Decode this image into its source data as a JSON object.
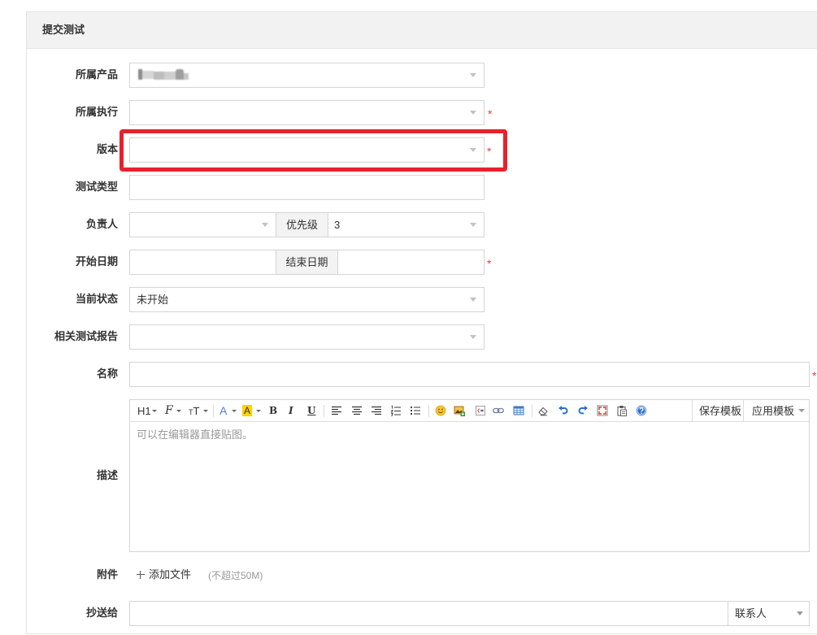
{
  "panel": {
    "title": "提交测试"
  },
  "required_mark": "*",
  "form": {
    "product": {
      "label": "所属产品"
    },
    "execution": {
      "label": "所属执行"
    },
    "build": {
      "label": "版本"
    },
    "type": {
      "label": "测试类型"
    },
    "owner": {
      "label": "负责人"
    },
    "priority": {
      "label": "优先级",
      "value": "3"
    },
    "begin": {
      "label": "开始日期"
    },
    "end": {
      "label": "结束日期"
    },
    "status": {
      "label": "当前状态",
      "value": "未开始"
    },
    "report": {
      "label": "相关测试报告"
    },
    "name": {
      "label": "名称"
    },
    "desc": {
      "label": "描述",
      "placeholder": "可以在编辑器直接贴图。"
    },
    "files": {
      "label": "附件",
      "add_label": "添加文件",
      "limit_note": "(不超过50M)"
    },
    "mailto": {
      "label": "抄送给",
      "contacts_label": "联系人"
    }
  },
  "editor": {
    "toolbar": {
      "heading": {
        "label": "H1",
        "icon": "heading-icon"
      },
      "font_family": {
        "label": "F",
        "icon": "font-family-icon"
      },
      "font_size": {
        "label": "T",
        "icon": "font-size-icon"
      },
      "font_color": {
        "label": "A",
        "icon": "font-color-icon",
        "color": "#4f80da"
      },
      "bg_color": {
        "label": "A",
        "icon": "background-color-icon",
        "color": "#ffd200"
      },
      "bold": {
        "label": "B"
      },
      "italic": {
        "label": "I"
      },
      "underline": {
        "label": "U"
      },
      "icons": [
        "align-left-icon",
        "align-center-icon",
        "align-right-icon",
        "ordered-list-icon",
        "unordered-list-icon",
        "emoji-icon",
        "image-icon",
        "code-icon",
        "link-icon",
        "table-icon",
        "eraser-icon",
        "undo-icon",
        "redo-icon",
        "fullscreen-icon",
        "paste-icon",
        "help-icon"
      ],
      "save_template": "保存模板",
      "apply_template": "应用模板"
    }
  },
  "colors": {
    "required": "#e8403a",
    "highlight": "#e8212b",
    "border": "#d5d5d5",
    "addon_bg": "#f3f3f3",
    "header_bg": "#f2f2f2",
    "placeholder": "#999999"
  }
}
